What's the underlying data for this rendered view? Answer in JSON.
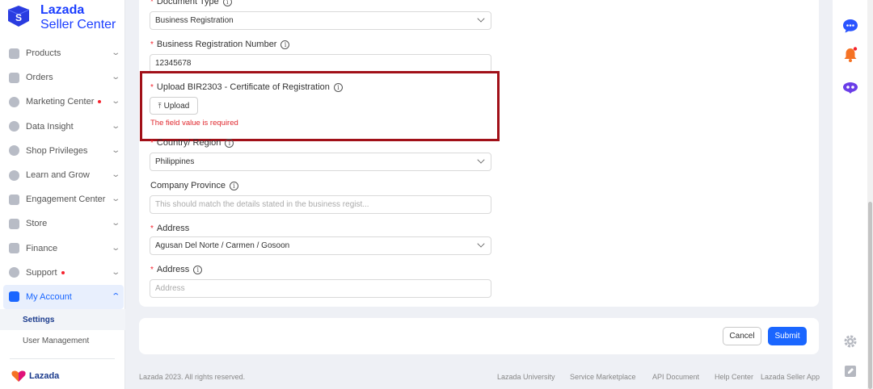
{
  "brand": {
    "line1": "Lazada",
    "line2": "Seller Center",
    "footer": "Lazada"
  },
  "sidebar": {
    "items": [
      {
        "label": "Products",
        "dot": false
      },
      {
        "label": "Orders",
        "dot": false
      },
      {
        "label": "Marketing Center",
        "dot": true
      },
      {
        "label": "Data Insight",
        "dot": false
      },
      {
        "label": "Shop Privileges",
        "dot": false
      },
      {
        "label": "Learn and Grow",
        "dot": false
      },
      {
        "label": "Engagement Center",
        "dot": false
      },
      {
        "label": "Store",
        "dot": false
      },
      {
        "label": "Finance",
        "dot": false
      },
      {
        "label": "Support",
        "dot": true
      },
      {
        "label": "My Account",
        "dot": false
      }
    ],
    "subitems": [
      {
        "label": "Settings"
      },
      {
        "label": "User Management"
      }
    ]
  },
  "form": {
    "document_type": {
      "label": "Document Type",
      "value": "Business Registration"
    },
    "business_reg_number": {
      "label": "Business Registration Number",
      "value": "12345678"
    },
    "upload": {
      "label": "Upload BIR2303 - Certificate of Registration",
      "button": "Upload",
      "error": "The field value is required"
    },
    "country": {
      "label": "Country/ Region",
      "value": "Philippines"
    },
    "province": {
      "label": "Company Province",
      "placeholder": "This should match the details stated in the business regist..."
    },
    "address_select": {
      "label": "Address",
      "value": "Agusan Del Norte / Carmen / Gosoon"
    },
    "address_text": {
      "label": "Address",
      "placeholder": "Address"
    }
  },
  "actions": {
    "cancel": "Cancel",
    "submit": "Submit"
  },
  "footer": {
    "copyright": "Lazada 2023. All rights reserved.",
    "links": [
      "Lazada University",
      "Service Marketplace",
      "API Document",
      "Help Center",
      "Lazada Seller App"
    ]
  },
  "colors": {
    "accent": "#1a66ff",
    "error": "#e0282e",
    "highlight": "#a11018"
  }
}
